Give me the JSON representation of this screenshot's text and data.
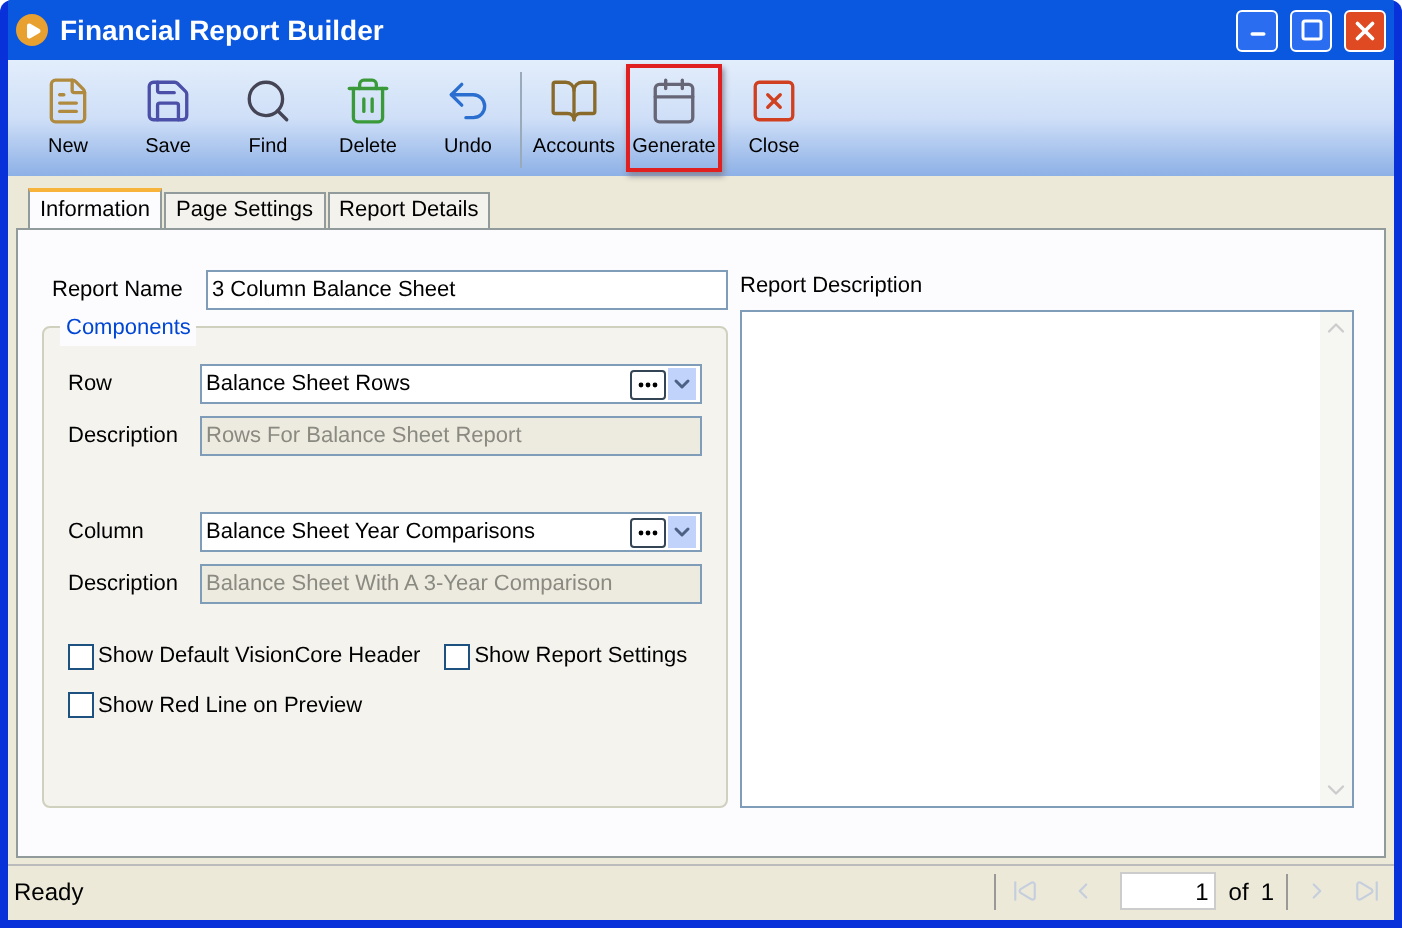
{
  "window": {
    "title": "Financial Report Builder"
  },
  "toolbar": [
    {
      "label": "New",
      "highlighted": false
    },
    {
      "label": "Save",
      "highlighted": false
    },
    {
      "label": "Find",
      "highlighted": false
    },
    {
      "label": "Delete",
      "highlighted": false
    },
    {
      "label": "Undo",
      "highlighted": false
    },
    {
      "label": "Accounts",
      "highlighted": false
    },
    {
      "label": "Generate",
      "highlighted": true
    },
    {
      "label": "Close",
      "highlighted": false
    }
  ],
  "tabs": [
    {
      "label": "Information",
      "selected": true
    },
    {
      "label": "Page Settings",
      "selected": false
    },
    {
      "label": "Report Details",
      "selected": false
    }
  ],
  "report_name": {
    "label": "Report Name",
    "value": "3 Column Balance Sheet"
  },
  "components": {
    "title": "Components",
    "fields": [
      {
        "label": "Row",
        "value": "Balance Sheet Rows",
        "description_label": "Description",
        "description": "Rows For Balance Sheet Report"
      },
      {
        "label": "Column",
        "value": "Balance Sheet Year Comparisons",
        "description_label": "Description",
        "description": "Balance Sheet With A 3-Year Comparison"
      }
    ],
    "checkboxes": [
      {
        "label": "Show Default VisionCore Header",
        "checked": false
      },
      {
        "label": "Show Report Settings",
        "checked": false
      },
      {
        "label": "Show Red Line on Preview",
        "checked": false
      }
    ]
  },
  "report_description": {
    "label": "Report Description"
  },
  "status_bar": {
    "status": "Ready",
    "page": "1",
    "of_label": "of",
    "total": "1"
  }
}
